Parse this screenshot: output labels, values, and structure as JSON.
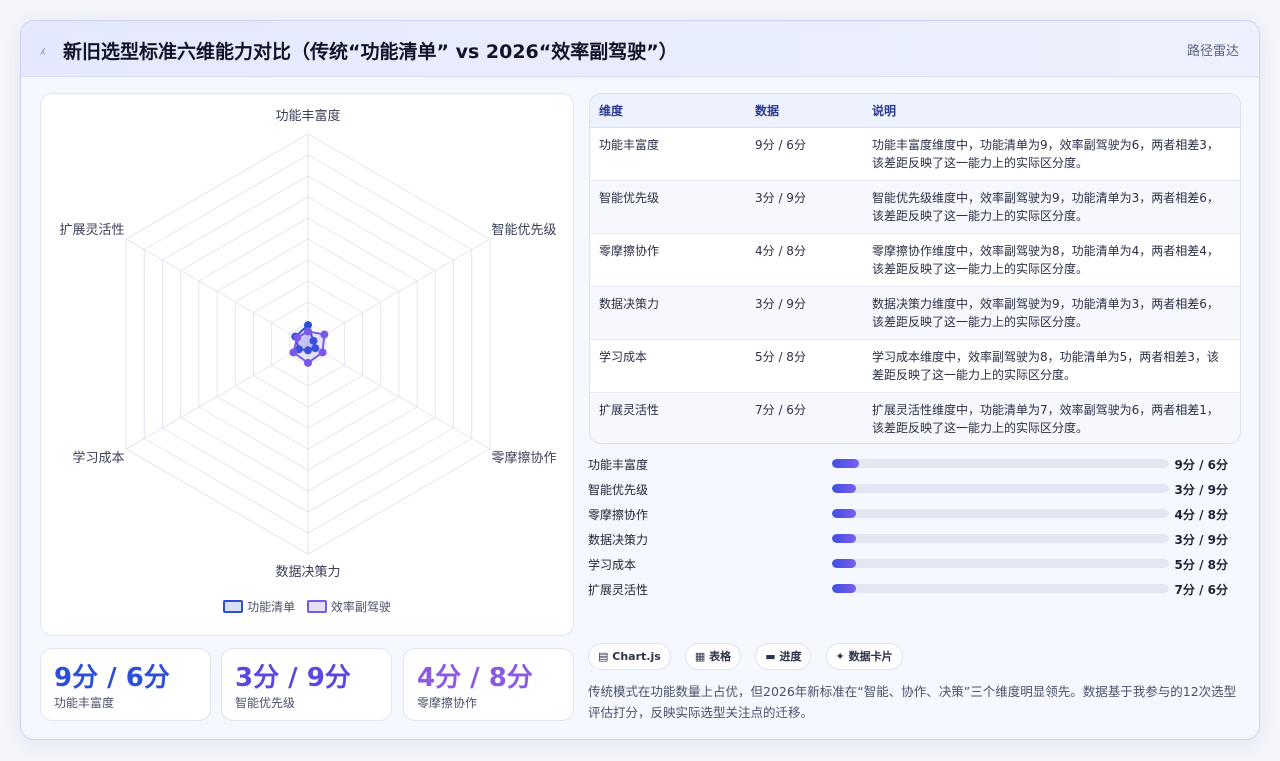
{
  "header": {
    "logo_icon": "sparkline-icon",
    "logo_glyph": "⁁",
    "title": "新旧选型标准六维能力对比（传统“功能清单” vs 2026“效率副驾驶”）",
    "badge": "路径雷达"
  },
  "chart_data": {
    "type": "radar",
    "axes": [
      "功能丰富度",
      "智能优先级",
      "零摩擦协作",
      "数据决策力",
      "学习成本",
      "扩展灵活性"
    ],
    "series": [
      {
        "name": "功能清单",
        "values": [
          9,
          3,
          4,
          3,
          5,
          7
        ],
        "color": "#2c4fd6"
      },
      {
        "name": "效率副驾驶",
        "values": [
          6,
          9,
          8,
          9,
          8,
          6
        ],
        "color": "#7a58e8"
      }
    ],
    "rmax": 100,
    "rings": 10,
    "grid": true,
    "legend": "bottom"
  },
  "stats": [
    {
      "value": "9分 / 6分",
      "label": "功能丰富度",
      "color": "#2c4fd6"
    },
    {
      "value": "3分 / 9分",
      "label": "智能优先级",
      "color": "#5a49e0"
    },
    {
      "value": "4分 / 8分",
      "label": "零摩擦协作",
      "color": "#8a5ae6"
    }
  ],
  "table": {
    "headers": [
      "维度",
      "数据",
      "说明"
    ],
    "rows": [
      {
        "dim": "功能丰富度",
        "data": "9分 / 6分",
        "desc": "功能丰富度维度中，功能清单为9，效率副驾驶为6，两者相差3，该差距反映了这一能力上的实际区分度。"
      },
      {
        "dim": "智能优先级",
        "data": "3分 / 9分",
        "desc": "智能优先级维度中，效率副驾驶为9，功能清单为3，两者相差6，该差距反映了这一能力上的实际区分度。"
      },
      {
        "dim": "零摩擦协作",
        "data": "4分 / 8分",
        "desc": "零摩擦协作维度中，效率副驾驶为8，功能清单为4，两者相差4，该差距反映了这一能力上的实际区分度。"
      },
      {
        "dim": "数据决策力",
        "data": "3分 / 9分",
        "desc": "数据决策力维度中，效率副驾驶为9，功能清单为3，两者相差6，该差距反映了这一能力上的实际区分度。"
      },
      {
        "dim": "学习成本",
        "data": "5分 / 8分",
        "desc": "学习成本维度中，效率副驾驶为8，功能清单为5，两者相差3，该差距反映了这一能力上的实际区分度。"
      },
      {
        "dim": "扩展灵活性",
        "data": "7分 / 6分",
        "desc": "扩展灵活性维度中，功能清单为7，效率副驾驶为6，两者相差1，该差距反映了这一能力上的实际区分度。"
      }
    ]
  },
  "bars": [
    {
      "name": "功能丰富度",
      "value": "9分 / 6分",
      "progress": 0.08
    },
    {
      "name": "智能优先级",
      "value": "3分 / 9分",
      "progress": 0.07
    },
    {
      "name": "零摩擦协作",
      "value": "4分 / 8分",
      "progress": 0.07
    },
    {
      "name": "数据决策力",
      "value": "3分 / 9分",
      "progress": 0.07
    },
    {
      "name": "学习成本",
      "value": "5分 / 8分",
      "progress": 0.07
    },
    {
      "name": "扩展灵活性",
      "value": "7分 / 6分",
      "progress": 0.07
    }
  ],
  "chips": [
    {
      "icon": "chart-icon",
      "glyph": "▤",
      "label": "Chart.js"
    },
    {
      "icon": "table-icon",
      "glyph": "▦",
      "label": "表格"
    },
    {
      "icon": "progress-icon",
      "glyph": "▬",
      "label": "进度"
    },
    {
      "icon": "sparkle-icon",
      "glyph": "✦",
      "label": "数据卡片"
    }
  ],
  "summary": "传统模式在功能数量上占优，但2026年新标准在“智能、协作、决策”三个维度明显领先。数据基于我参与的12次选型评估打分，反映实际选型关注点的迁移。"
}
